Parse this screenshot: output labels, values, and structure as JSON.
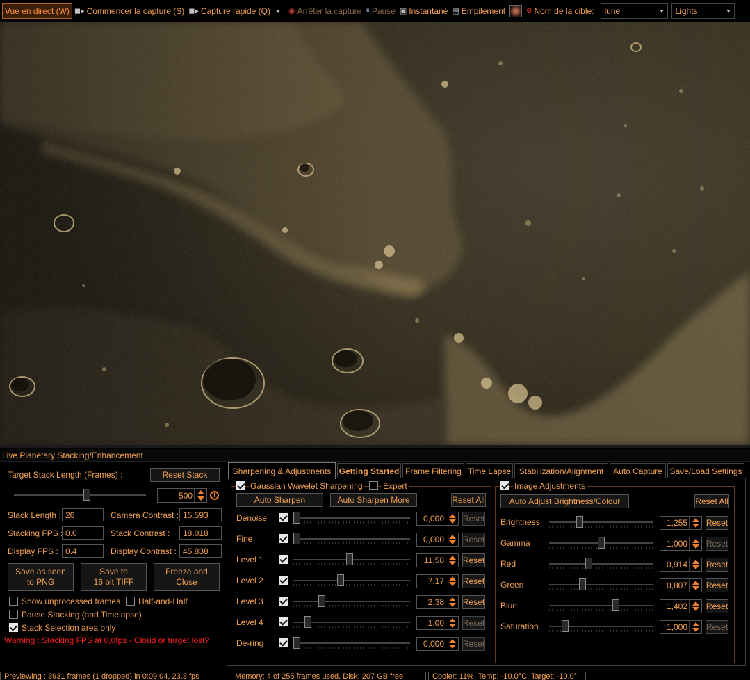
{
  "toolbar": {
    "live_view": "Vue en direct (W)",
    "start_capture": "Commencer la capture (S)",
    "quick_capture": "Capture rapide (Q)",
    "stop_capture": "Arrêter la capture",
    "pause": "Pause",
    "snapshot": "Instantané",
    "stacking": "Empilement",
    "target_label": "Nom de la cible:",
    "target_value": "lune",
    "frame_type": "Lights"
  },
  "panel": {
    "title": "Live Planetary Stacking/Enhancement",
    "target_stack_label": "Target Stack Length (Frames) :",
    "reset_stack": "Reset Stack",
    "stack_length_value": "500",
    "stack_length_label": "Stack Length :",
    "stack_length": "26",
    "camera_contrast_label": "Camera Contrast :",
    "camera_contrast": "15.593",
    "stacking_fps_label": "Stacking FPS :",
    "stacking_fps": "0.0",
    "stack_contrast_label": "Stack Contrast :",
    "stack_contrast": "18.018",
    "display_fps_label": "Display FPS :",
    "display_fps": "0.4",
    "display_contrast_label": "Display Contrast :",
    "display_contrast": "45.838",
    "save_png_l1": "Save as seen",
    "save_png_l2": "to PNG",
    "save_tiff_l1": "Save to",
    "save_tiff_l2": "16 bit TIFF",
    "freeze_l1": "Freeze and",
    "freeze_l2": "Close",
    "show_unprocessed": "Show unprocessed frames",
    "half_and_half": "Half-and-Half",
    "pause_stacking": "Pause Stacking (and Timelapse)",
    "stack_selection": "Stack Selection area only",
    "warning": "Warning : Stacking FPS at 0,0fps - Cloud or target lost?"
  },
  "tabs": [
    "Sharpening & Adjustments",
    "Getting Started",
    "Frame Filtering",
    "Time Lapse",
    "Stabilization/Alignment",
    "Auto Capture",
    "Save/Load Settings"
  ],
  "sharpening": {
    "gaussian_label": "Gaussian Wavelet Sharpening",
    "expert_label": "Expert",
    "auto_sharpen": "Auto Sharpen",
    "auto_sharpen_more": "Auto Sharpen More",
    "reset_all": "Reset All",
    "reset": "Reset",
    "rows": [
      {
        "label": "Denoise",
        "value": "0,000",
        "level": 0.0,
        "reset_active": false
      },
      {
        "label": "Fine",
        "value": "0,000",
        "level": 0.0,
        "reset_active": false
      },
      {
        "label": "Level 1",
        "value": "11,58",
        "level": 0.48,
        "reset_active": true
      },
      {
        "label": "Level 2",
        "value": "7,17",
        "level": 0.4,
        "reset_active": true
      },
      {
        "label": "Level 3",
        "value": "2,38",
        "level": 0.23,
        "reset_active": true
      },
      {
        "label": "Level 4",
        "value": "1,00",
        "level": 0.1,
        "reset_active": false
      },
      {
        "label": "De-ring",
        "value": "0,000",
        "level": 0.0,
        "reset_active": false
      }
    ]
  },
  "image_adjust": {
    "title": "Image Adjustments",
    "auto_adjust": "Auto Adjust Brightness/Colour",
    "reset_all": "Reset All",
    "reset": "Reset",
    "rows": [
      {
        "label": "Brightness",
        "value": "1,255",
        "level": 0.28,
        "reset_active": true
      },
      {
        "label": "Gamma",
        "value": "1,000",
        "level": 0.5,
        "reset_active": false
      },
      {
        "label": "Red",
        "value": "0,914",
        "level": 0.37,
        "reset_active": true
      },
      {
        "label": "Green",
        "value": "0,807",
        "level": 0.31,
        "reset_active": true
      },
      {
        "label": "Blue",
        "value": "1,402",
        "level": 0.65,
        "reset_active": true
      },
      {
        "label": "Saturation",
        "value": "1,000",
        "level": 0.13,
        "reset_active": false
      }
    ]
  },
  "status": {
    "previewing": "Previewing : 3931 frames (1 dropped) in 0:09:04, 23.3 fps",
    "memory": "Memory: 4 of 255 frames used. Disk: 207 GB free",
    "cooler": "Cooler: 11%, Temp: -10.0°C, Target: -10.0°"
  }
}
